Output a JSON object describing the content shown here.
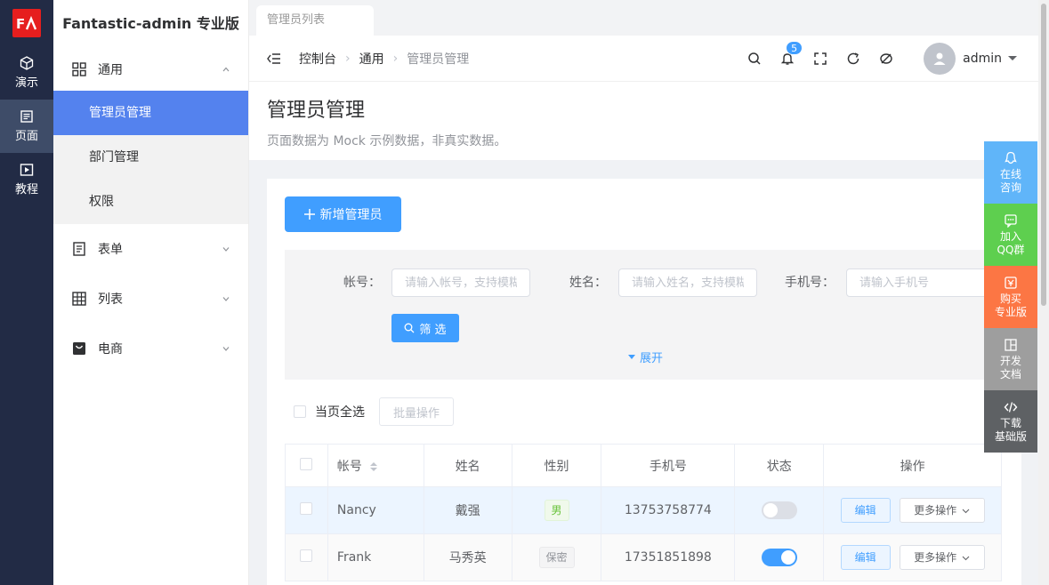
{
  "rail": {
    "logo": "FA",
    "items": [
      {
        "label": "演示",
        "icon": "cube-icon"
      },
      {
        "label": "页面",
        "icon": "document-icon"
      },
      {
        "label": "教程",
        "icon": "video-icon"
      }
    ]
  },
  "sidebar": {
    "title": "Fantastic-admin 专业版",
    "groups": [
      {
        "label": "通用",
        "icon": "grid-icon"
      },
      {
        "label": "表单",
        "icon": "form-icon"
      },
      {
        "label": "列表",
        "icon": "table-icon"
      },
      {
        "label": "电商",
        "icon": "bag-icon"
      }
    ],
    "sub_items": [
      "管理员管理",
      "部门管理",
      "权限"
    ]
  },
  "tabs": [
    "管理员列表"
  ],
  "breadcrumb": [
    "控制台",
    "通用",
    "管理员管理"
  ],
  "toolbar": {
    "notifications": "5",
    "user": "admin"
  },
  "page": {
    "title": "管理员管理",
    "description": "页面数据为 Mock 示例数据，非真实数据。"
  },
  "actions": {
    "add_label": "新增管理员"
  },
  "filter": {
    "account_label": "帐号：",
    "account_placeholder": "请输入帐号，支持模糊查询",
    "name_label": "姓名：",
    "name_placeholder": "请输入姓名，支持模糊查询",
    "phone_label": "手机号：",
    "phone_placeholder": "请输入手机号",
    "search_label": "筛 选",
    "expand_label": "展开"
  },
  "batch": {
    "select_all_label": "当页全选",
    "batch_label": "批量操作"
  },
  "table": {
    "columns": [
      "帐号",
      "姓名",
      "性别",
      "手机号",
      "状态",
      "操作"
    ],
    "rows": [
      {
        "account": "Nancy",
        "name": "戴强",
        "gender": "男",
        "phone": "13753758774",
        "enabled": false
      },
      {
        "account": "Frank",
        "name": "马秀英",
        "gender": "保密",
        "phone": "17351851898",
        "enabled": true
      }
    ],
    "edit_label": "编辑",
    "more_label": "更多操作"
  },
  "float_panel": [
    {
      "label": "在线咨询",
      "line1": "在线",
      "line2": "咨询",
      "color": "#60b5f9"
    },
    {
      "label": "加入QQ群",
      "line1": "加入",
      "line2": "QQ群",
      "color": "#5ecf4f"
    },
    {
      "label": "购买专业版",
      "line1": "购买",
      "line2": "专业版",
      "color": "#fc7644"
    },
    {
      "label": "开发文档",
      "line1": "开发",
      "line2": "文档",
      "color": "#9e9e9e"
    },
    {
      "label": "下载基础版",
      "line1": "下载",
      "line2": "基础版",
      "color": "#5e6164"
    }
  ],
  "colors": {
    "primary": "#409eff",
    "rail_bg": "#222b45",
    "menu_active": "#5482ee"
  }
}
